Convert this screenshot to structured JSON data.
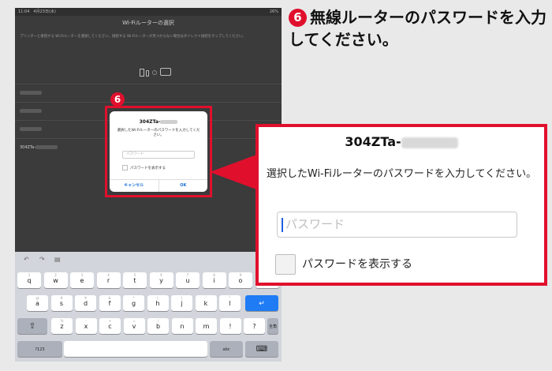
{
  "status": {
    "time": "11:04　4月23日(水)",
    "battery": "26%"
  },
  "nav_title": "Wi-Fiルーターの選択",
  "instructions": "プリンターと接続する Wi-Fiルーターを選択してください。接続する Wi-Fiルーターが見つからない場合はダイレクト接続をタップしてください。",
  "ssid_list": [
    "",
    "",
    "",
    "304ZTa-"
  ],
  "mini_dialog": {
    "title": "304ZTa-",
    "message": "選択したWi-Fiルーターのパスワードを入力してください。",
    "placeholder": "パスワード",
    "show_password": "パスワードを表示する",
    "cancel": "キャンセル",
    "ok": "OK"
  },
  "step_number": "6",
  "heading": "無線ルーターのパスワードを入力してください。",
  "big_dialog": {
    "title": "304ZTa-",
    "message": "選択したWi-Fiルーターのパスワードを入力してください。",
    "placeholder": "パスワード",
    "show_password": "パスワードを表示する"
  },
  "keyboard": {
    "row1": [
      [
        "q",
        "1"
      ],
      [
        "w",
        "2"
      ],
      [
        "e",
        "3"
      ],
      [
        "r",
        "4"
      ],
      [
        "t",
        "5"
      ],
      [
        "y",
        "6"
      ],
      [
        "u",
        "7"
      ],
      [
        "i",
        "8"
      ],
      [
        "o",
        "9"
      ],
      [
        "p",
        "0"
      ]
    ],
    "row2": [
      [
        "a",
        "@"
      ],
      [
        "s",
        "#"
      ],
      [
        "d",
        "¥"
      ],
      [
        "f",
        "&"
      ],
      [
        "g",
        "*"
      ],
      [
        "h",
        "("
      ],
      [
        "j",
        ")"
      ],
      [
        "k",
        "'"
      ],
      [
        "l",
        "\""
      ]
    ],
    "row3": [
      [
        "z",
        "%"
      ],
      [
        "x",
        "-"
      ],
      [
        "c",
        "+"
      ],
      [
        "v",
        "="
      ],
      [
        "b",
        "/"
      ],
      [
        "n",
        ";"
      ],
      [
        "m",
        ":"
      ],
      [
        "!",
        ","
      ],
      [
        "?",
        "."
      ]
    ],
    "shift": "⇧",
    "enter": "↵",
    "zenkaku": "全角",
    "num": "?123",
    "abc": "abc",
    "hide": "⌨"
  },
  "colors": {
    "accent": "#e0102d",
    "ios_blue": "#1a6fd8"
  }
}
